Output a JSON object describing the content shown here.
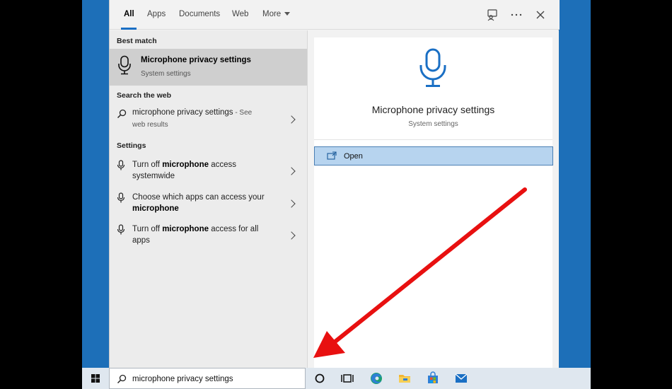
{
  "tabs": [
    {
      "label": "All",
      "active": true
    },
    {
      "label": "Apps",
      "active": false
    },
    {
      "label": "Documents",
      "active": false
    },
    {
      "label": "Web",
      "active": false
    },
    {
      "label": "More",
      "active": false
    }
  ],
  "header_icons": [
    "feedback-icon",
    "more-options-icon",
    "close-icon"
  ],
  "left": {
    "best_match_header": "Best match",
    "best_match": {
      "title": "Microphone privacy settings",
      "subtitle": "System settings",
      "icon": "microphone-icon"
    },
    "web_header": "Search the web",
    "web_result": {
      "query": "microphone privacy settings",
      "suffix_a": " - See",
      "suffix_b": "web results"
    },
    "settings_header": "Settings",
    "settings_results": [
      {
        "pre": "Turn off ",
        "bold": "microphone",
        "post": " access",
        "line2": "systemwide"
      },
      {
        "pre": "Choose which apps can access your",
        "bold": "microphone",
        "post": "",
        "line2": ""
      },
      {
        "pre": "Turn off ",
        "bold": "microphone",
        "post": " access for all",
        "line2": "apps"
      }
    ]
  },
  "detail": {
    "title": "Microphone privacy settings",
    "subtitle": "System settings",
    "icon": "microphone-icon",
    "action_label": "Open"
  },
  "taskbar": {
    "search_value": "microphone privacy settings",
    "icons": [
      "start-icon",
      "cortana-icon",
      "task-view-icon",
      "edge-icon",
      "file-explorer-icon",
      "store-icon",
      "mail-icon"
    ]
  },
  "colors": {
    "accent": "#1a6fc4",
    "highlight": "#b7d4ef",
    "selected_row": "#cfcfcf",
    "arrow": "#e81010",
    "desktop": "#1d6fb8"
  }
}
